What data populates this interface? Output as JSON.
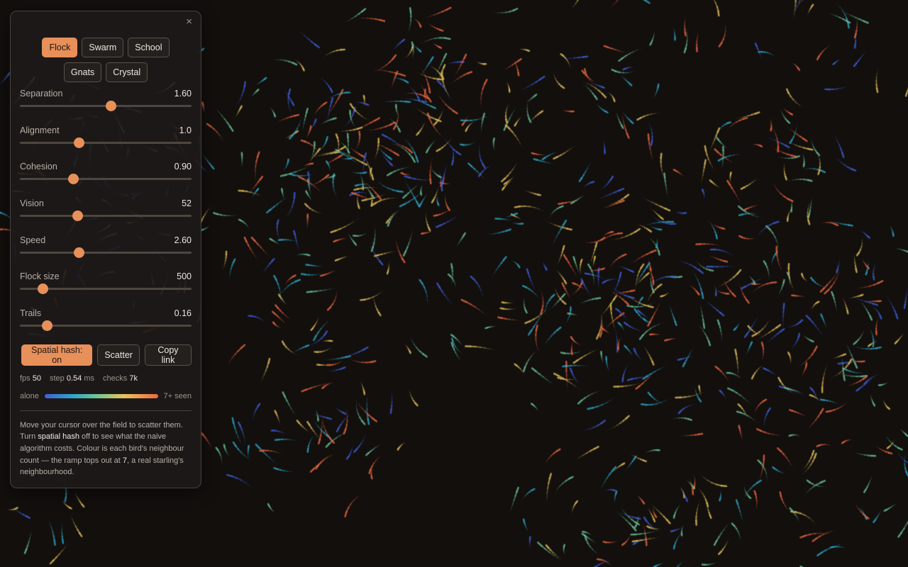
{
  "panel": {
    "close_label": "×",
    "presets": [
      {
        "label": "Flock",
        "active": true
      },
      {
        "label": "Swarm",
        "active": false
      },
      {
        "label": "School",
        "active": false
      },
      {
        "label": "Gnats",
        "active": false
      },
      {
        "label": "Crystal",
        "active": false
      }
    ],
    "sliders": [
      {
        "label": "Separation",
        "value": "1.60",
        "fraction": 0.53
      },
      {
        "label": "Alignment",
        "value": "1.0",
        "fraction": 0.345
      },
      {
        "label": "Cohesion",
        "value": "0.90",
        "fraction": 0.31
      },
      {
        "label": "Vision",
        "value": "52",
        "fraction": 0.335
      },
      {
        "label": "Speed",
        "value": "2.60",
        "fraction": 0.345
      },
      {
        "label": "Flock size",
        "value": "500",
        "fraction": 0.135
      },
      {
        "label": "Trails",
        "value": "0.16",
        "fraction": 0.16
      }
    ],
    "actions": {
      "spatial_hash": "Spatial hash: on",
      "scatter": "Scatter",
      "copy_link": "Copy link"
    },
    "stats": {
      "fps_label": "fps",
      "fps": "50",
      "step_label": "step",
      "step": "0.54",
      "step_unit": "ms",
      "checks_label": "checks",
      "checks": "7k"
    },
    "legend": {
      "low": "alone",
      "high": "7+ seen"
    },
    "help": {
      "p1": "Move your cursor over the field to scatter them. Turn ",
      "em1": "spatial hash",
      "p2": " off to see what the naive algorithm costs. Colour is each bird's neighbour count — the ramp tops out at ",
      "em2": "7",
      "p3": ", a real starling's neighbourhood."
    }
  },
  "colors": {
    "accent": "#e8905a",
    "background": "#120f0d",
    "ramp": [
      "#3f5fd8",
      "#2fa6c6",
      "#6cc49a",
      "#e8c35a",
      "#ee6840"
    ]
  }
}
